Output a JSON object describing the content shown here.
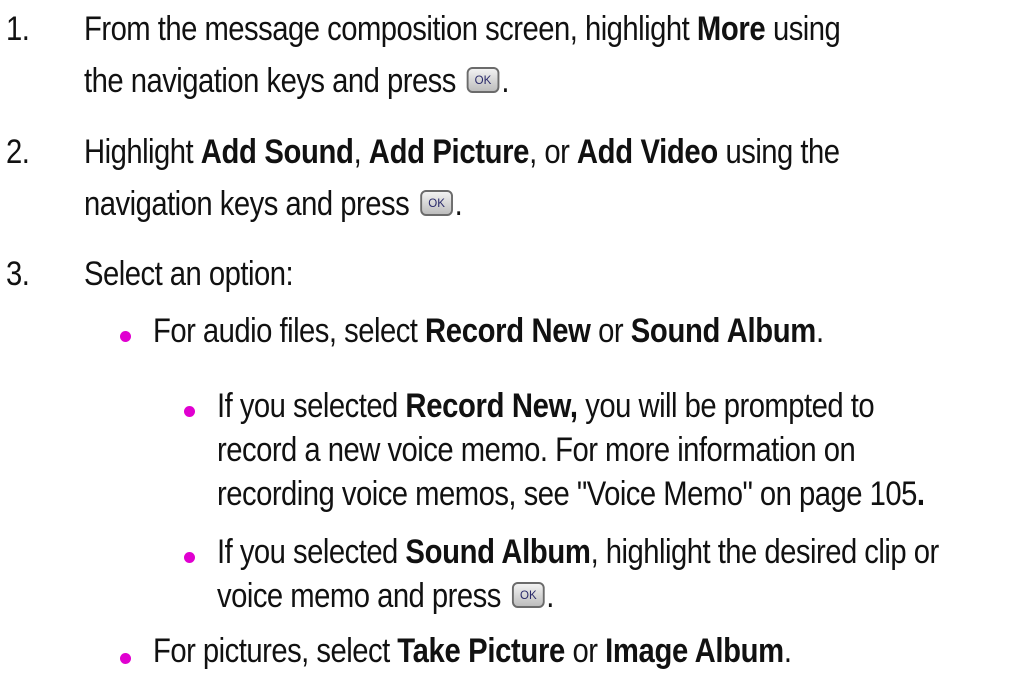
{
  "steps": [
    {
      "num": "1.",
      "line1_pre": "From the message composition screen, highlight ",
      "line1_bold": "More",
      "line1_post": " using",
      "line2_pre": "the navigation keys and press ",
      "line2_post": "."
    },
    {
      "num": "2.",
      "line1_pre": "Highlight ",
      "line1_b1": "Add Sound",
      "line1_sep1": ", ",
      "line1_b2": "Add Picture",
      "line1_sep2": ", or ",
      "line1_b3": "Add Video",
      "line1_post": " using the",
      "line2_pre": "navigation keys and press ",
      "line2_post": "."
    },
    {
      "num": "3.",
      "text": "Select an option:"
    }
  ],
  "audio_bullet": {
    "pre": "For audio files, select ",
    "b1": "Record New",
    "mid": " or ",
    "b2": "Sound Album",
    "post": "."
  },
  "record_new_bullet": {
    "pre": "If you selected ",
    "bold": "Record New,",
    "line1_post": " you will be prompted to",
    "line2": "record a new voice memo. For more information on",
    "line3": "recording voice memos, see \"Voice Memo\" on page 105",
    "line3_bold": "."
  },
  "sound_album_bullet": {
    "pre": "If you selected ",
    "bold": "Sound Album",
    "line1_post": ", highlight the desired clip or",
    "line2_pre": "voice memo and press ",
    "line2_post": "."
  },
  "pictures_bullet": {
    "pre": "For pictures, select ",
    "b1": "Take Picture",
    "mid": " or ",
    "b2": "Image Album",
    "post": "."
  },
  "ok_key_label": "OK",
  "colors": {
    "bullet": "#e000d0",
    "text": "#111111"
  },
  "icons": {
    "ok_key": "ok-key-icon",
    "bullet": "bullet-dot-icon"
  }
}
